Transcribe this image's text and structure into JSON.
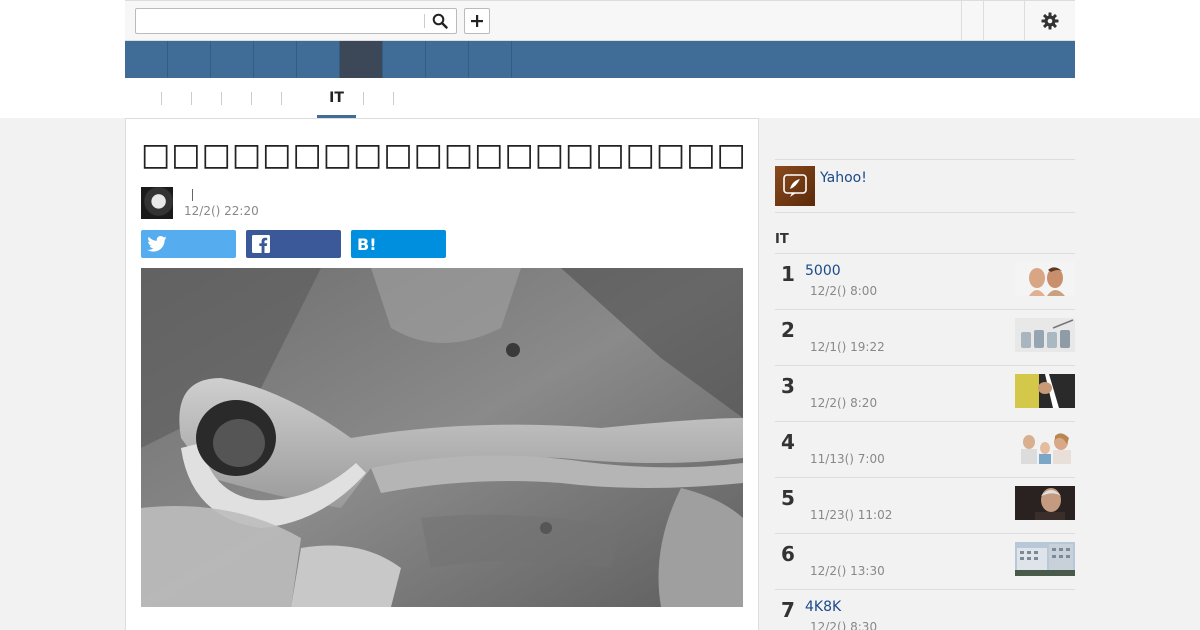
{
  "search": {
    "placeholder": "",
    "value": ""
  },
  "nav": {
    "items": [
      "",
      "",
      "",
      "",
      "",
      "",
      "",
      "",
      ""
    ],
    "active_index": 5
  },
  "subnav": {
    "items": [
      "",
      "",
      "",
      "",
      "",
      "IT",
      "",
      ""
    ],
    "active": "IT"
  },
  "article": {
    "headline": "□□□□□□□□□□□□□□□□□□□□",
    "author": "",
    "date": "12/2() 22:20",
    "share": {
      "twitter": "",
      "facebook": "",
      "hatena": "B!"
    }
  },
  "sidebar": {
    "promo_text": "Yahoo!",
    "ranking_title": "IT",
    "ranking": [
      {
        "rank": "1",
        "title": "5000",
        "date": "12/2() 8:00"
      },
      {
        "rank": "2",
        "title": "",
        "date": "12/1() 19:22"
      },
      {
        "rank": "3",
        "title": "",
        "date": "12/2() 8:20"
      },
      {
        "rank": "4",
        "title": "",
        "date": "11/13() 7:00"
      },
      {
        "rank": "5",
        "title": "",
        "date": "11/23() 11:02"
      },
      {
        "rank": "6",
        "title": "",
        "date": "12/2() 13:30"
      },
      {
        "rank": "7",
        "title": "4K8K",
        "date": "12/2() 8:30"
      }
    ]
  },
  "colors": {
    "nav_bg": "#406d98",
    "nav_active": "#3c4757",
    "twitter": "#55acee",
    "facebook": "#3b5998",
    "hatena": "#008fde",
    "link": "#1a4a8a"
  },
  "icons": [
    "search-icon",
    "plus-icon",
    "gear-icon",
    "twitter-icon",
    "facebook-icon",
    "feather-icon"
  ]
}
